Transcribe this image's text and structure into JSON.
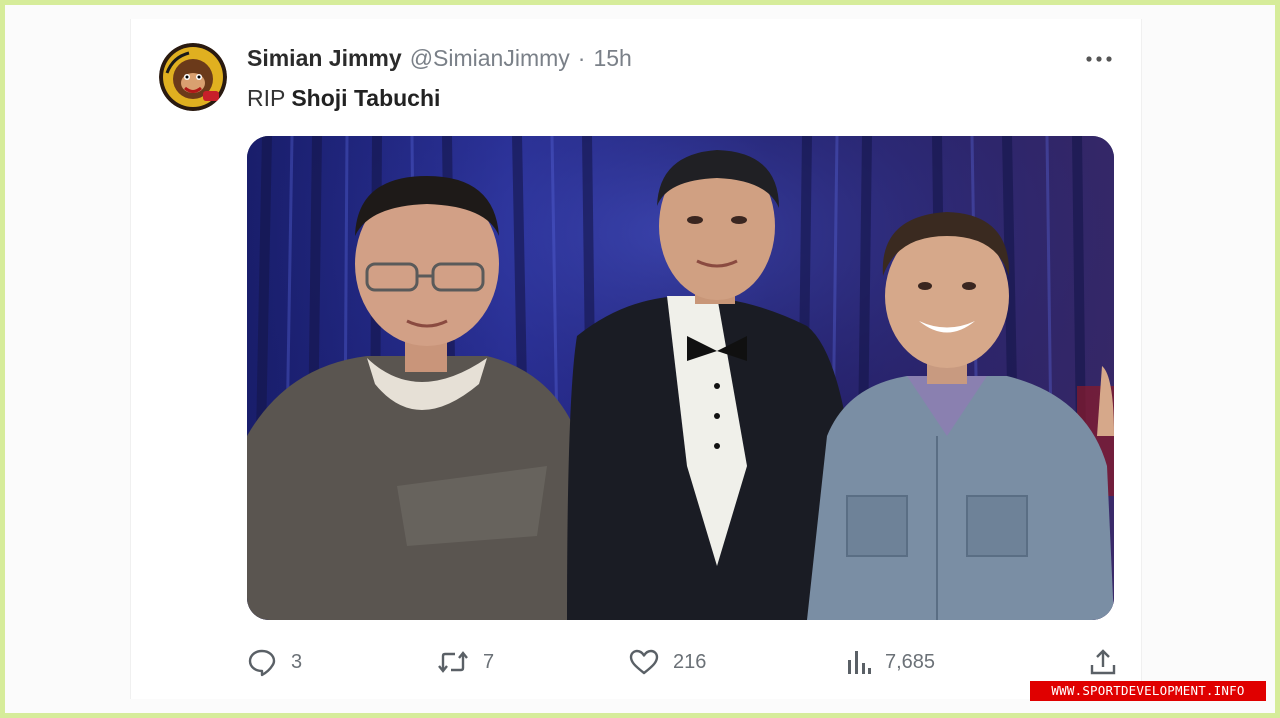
{
  "tweet": {
    "author": {
      "display_name": "Simian Jimmy",
      "handle": "@SimianJimmy",
      "separator": "·",
      "time": "15h"
    },
    "text_prefix": "RIP",
    "text_mention": "Shoji Tabuchi",
    "actions": {
      "replies": "3",
      "retweets": "7",
      "likes": "216",
      "views": "7,685"
    }
  },
  "icons": {
    "more": "more-horizontal-icon",
    "reply": "speech-bubble-icon",
    "retweet": "retweet-arrows-icon",
    "like": "heart-icon",
    "views": "bar-chart-icon",
    "share": "share-upload-icon"
  },
  "watermark": {
    "text": "WWW.SPORTDEVELOPMENT.INFO"
  },
  "colors": {
    "page_border": "#d6ec9a",
    "muted_text": "#7a8088",
    "watermark_bg": "#e00000"
  }
}
